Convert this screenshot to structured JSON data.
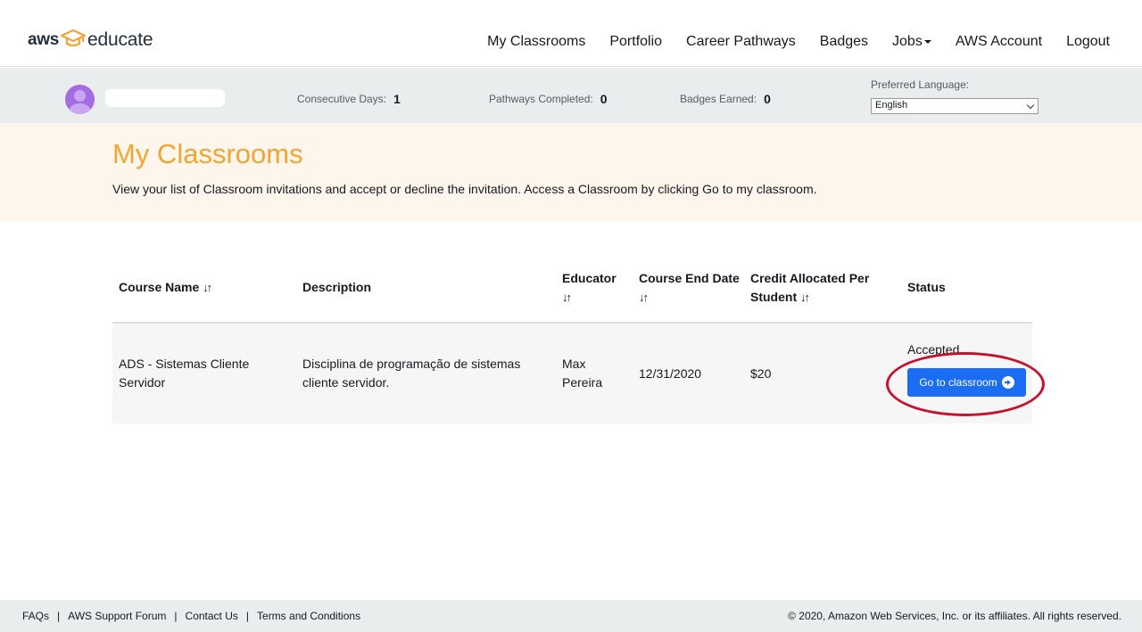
{
  "header": {
    "logo": {
      "aws": "aws",
      "educate": "educate"
    },
    "nav": [
      "My Classrooms",
      "Portfolio",
      "Career Pathways",
      "Badges",
      "Jobs",
      "AWS Account",
      "Logout"
    ]
  },
  "stats": {
    "consecutive_days_label": "Consecutive Days:",
    "consecutive_days": "1",
    "pathways_label": "Pathways Completed:",
    "pathways": "0",
    "badges_label": "Badges Earned:",
    "badges": "0",
    "language_label": "Preferred Language:",
    "language_value": "English"
  },
  "hero": {
    "title": "My Classrooms",
    "subtitle": "View your list of Classroom invitations and accept or decline the invitation. Access a Classroom by clicking Go to my classroom."
  },
  "table": {
    "headers": {
      "course_name": "Course Name",
      "description": "Description",
      "educator": "Educator",
      "end_date": "Course End Date",
      "credit_line1": "Credit Allocated Per",
      "credit_line2": "Student",
      "status": "Status"
    },
    "sort_symbol": "↓↑",
    "rows": [
      {
        "course_line1": "ADS - Sistemas Cliente",
        "course_line2": "Servidor",
        "desc_line1": "Disciplina de programação de sistemas",
        "desc_line2": "cliente servidor.",
        "educator_line1": "Max",
        "educator_line2": "Pereira",
        "end_date": "12/31/2020",
        "credit": "$20",
        "status": "Accepted",
        "button": "Go to classroom"
      }
    ]
  },
  "footer": {
    "links": [
      "FAQs",
      "AWS Support Forum",
      "Contact Us",
      "Terms and Conditions"
    ],
    "separator": "|",
    "copyright": "© 2020, Amazon Web Services, Inc. or its affiliates. All rights reserved."
  },
  "colors": {
    "accent_orange": "#f3a534",
    "button_blue": "#1b6ef3",
    "annotation_red": "#c8102e",
    "avatar_purple": "#a46be3"
  }
}
